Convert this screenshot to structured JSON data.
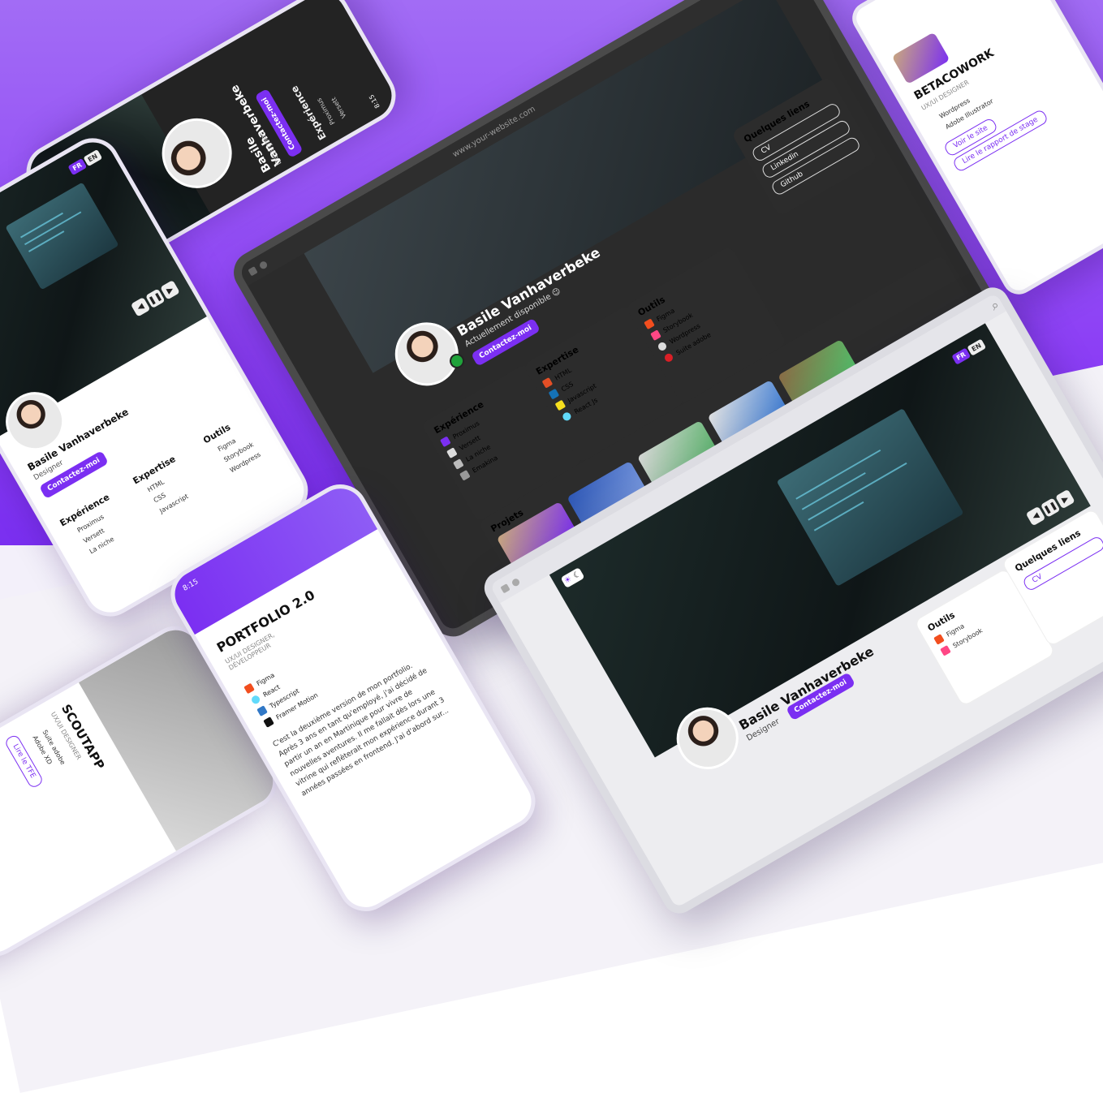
{
  "profile": {
    "name": "Basile Vanhaverbeke",
    "status": "Actuellement disponible 😉",
    "role": "Designer",
    "role_alt": "Dessigner",
    "contact_button": "Contactez-moi"
  },
  "lang": {
    "fr": "FR",
    "en": "EN"
  },
  "sections": {
    "experience": "Expérience",
    "expertise": "Expertise",
    "tools": "Outils",
    "links": "Quelques liens",
    "projects": "Projets"
  },
  "experience_items": [
    "Proximus",
    "Versett",
    "La niche",
    "Emakina"
  ],
  "expertise_items": [
    "HTML",
    "CSS",
    "Javascript",
    "React Js"
  ],
  "tools_items": [
    "Figma",
    "Storybook",
    "Wordpress",
    "Suite adobe"
  ],
  "links_items": [
    "CV",
    "Linkedin",
    "Github"
  ],
  "browser": {
    "url": "www.your-website.com"
  },
  "time": "8:15",
  "project_portfolio": {
    "title": "PORTFOLIO 2.0",
    "subtitle": "UX/UI DESIGNER, DÉVELOPPEUR",
    "tools": [
      "Figma",
      "React",
      "Typescript",
      "Framer Motion"
    ],
    "description": "C'est la deuxième version de mon portfolio. Après 3 ans en tant qu'employé, j'ai décidé de partir un an en Martinique pour vivre de nouvelles aventures. Il me fallait dès lors une vitrine qui reflèterait mon expérience durant 3 années passées en frontend. J'ai d'abord sur..."
  },
  "project_betacowork": {
    "title": "BETACOWORK",
    "subtitle": "UX/UI DESIGNER",
    "tools": [
      "Wordpress",
      "Adobe Illustrator"
    ],
    "buttons": [
      "Voir le site",
      "Lire le rapport de stage"
    ]
  },
  "project_scoutapp": {
    "title": "SCOUTAPP",
    "subtitle": "UX/UI DESIGNER",
    "tools": [
      "Suite adobe",
      "Adobe XD"
    ],
    "button": "Lire le TFE"
  },
  "colors": {
    "accent": "#7b2ff2",
    "dark_bg": "#232323",
    "card_dark": "#2c2c2c",
    "status": "#1fa23a"
  }
}
